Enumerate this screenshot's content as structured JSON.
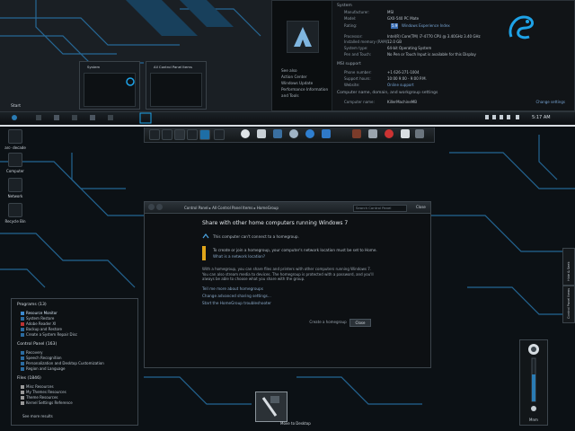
{
  "top_preview": {
    "system_header": "System",
    "left_links": [
      "See also",
      "Action Center",
      "Windows Update",
      "Performance Information and Tools"
    ],
    "fields": [
      {
        "label": "Manufacturer:",
        "value": "MSI"
      },
      {
        "label": "Model:",
        "value": "GX0-540 PC Mate"
      },
      {
        "label": "Rating:",
        "value": "Windows Experience Index"
      },
      {
        "label": "Processor:",
        "value": "Intel(R) Core(TM) i7-4770 CPU @ 3.40GHz   3.40 GHz"
      },
      {
        "label": "Installed memory (RAM):",
        "value": "12.0 GB"
      },
      {
        "label": "System type:",
        "value": "64-bit Operating System"
      },
      {
        "label": "Pen and Touch:",
        "value": "No Pen or Touch Input is available for this Display"
      }
    ],
    "rating_value": "5.9",
    "support_header": "MSI support",
    "support_fields": [
      {
        "label": "Phone number:",
        "value": "+1 626-271-1004"
      },
      {
        "label": "Support hours:",
        "value": "10:00 9:00 - 9:00 P.M."
      },
      {
        "label": "Website:",
        "value": "Online support"
      }
    ],
    "computer_header": "Computer name, domain, and workgroup settings",
    "computer_name_label": "Computer name:",
    "computer_name_value": "KillerMachineMB",
    "change_settings": "Change settings",
    "thumbs": [
      "System",
      "All Control Panel Items"
    ],
    "start_label": "Start",
    "clock": "5:17 AM"
  },
  "desktop": {
    "icons": [
      "arc- decade",
      "Computer",
      "Network",
      "Recycle Bin"
    ]
  },
  "homegroup": {
    "breadcrumb": [
      "Control Panel",
      "All Control Panel Items",
      "HomeGroup"
    ],
    "search_placeholder": "Search Control Panel",
    "close": "Close",
    "title": "Share with other home computers running Windows 7",
    "cant_connect": "This computer can't connect to a homegroup.",
    "notice_line1": "To create or join a homegroup, your computer's network location must be set to Home.",
    "notice_line2": "What is a network location?",
    "paragraph": "With a homegroup, you can share files and printers with other computers running Windows 7. You can also stream media to devices. The homegroup is protected with a password, and you'll always be able to choose what you share with the group.",
    "links": [
      "Tell me more about homegroups",
      "Change advanced sharing settings...",
      "Start the HomeGroup troubleshooter"
    ],
    "create_button": "Create a homegroup",
    "cancel_button": "Close"
  },
  "start_menu": {
    "sections": [
      {
        "header": "Programs (13)",
        "items": [
          "Resource Monitor",
          "System Restore",
          "Adobe Reader XI",
          "Backup and Restore",
          "Create a System Repair Disc"
        ]
      },
      {
        "header": "Control Panel (163)",
        "items": [
          "Recovery",
          "Speech Recognition",
          "Personalization and Desktop Customization",
          "Region and Language"
        ]
      },
      {
        "header": "Files (1846)",
        "items": [
          "Misc Resources",
          "My Themes Resources",
          "Theme Resources",
          "Kernel Settings Reference"
        ]
      }
    ],
    "see_more": "See more results"
  },
  "gadget": {
    "label": "Mnm"
  },
  "side_tabs": [
    "Hide & Seek",
    "Control Panel Items"
  ],
  "tile_label": "Move to Desktop",
  "colors": {
    "accent": "#1ea3e8",
    "circuit": "#2a7bb3",
    "warning": "#e0a51a"
  }
}
